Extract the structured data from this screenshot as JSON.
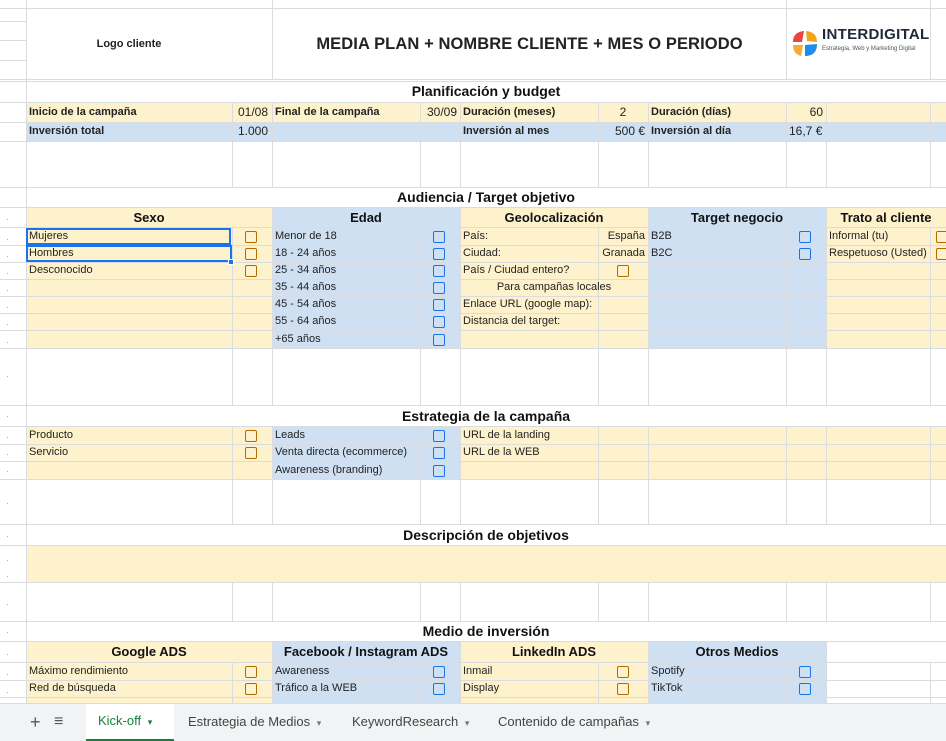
{
  "header": {
    "logo_placeholder": "Logo cliente",
    "title": "MEDIA PLAN + NOMBRE CLIENTE + MES O PERIODO",
    "brand_name": "INTERDIGITAL",
    "brand_tagline": "Estrategia, Web y Marketing Digital",
    "brand_colors": {
      "red": "#e8453c",
      "orange": "#f7a21b",
      "blue": "#1f8ee8"
    }
  },
  "planning": {
    "section_title": "Planificación y budget",
    "start_label": "Inicio de la campaña",
    "start_value": "01/08",
    "end_label": "Final de la campaña",
    "end_value": "30/09",
    "months_label": "Duración (meses)",
    "months_value": "2",
    "days_label": "Duración (días)",
    "days_value": "60",
    "total_label": "Inversión total",
    "total_value": "1.000",
    "monthly_label": "Inversión al mes",
    "monthly_value": "500 €",
    "daily_label": "Inversión al día",
    "daily_value": "16,7 €"
  },
  "audience": {
    "section_title": "Audiencia / Target objetivo",
    "sexo": {
      "header": "Sexo",
      "items": [
        "Mujeres",
        "Hombres",
        "Desconocido"
      ]
    },
    "edad": {
      "header": "Edad",
      "items": [
        "Menor de 18",
        "18 - 24 años",
        "25 - 34 años",
        "35 - 44 años",
        "45 - 54 años",
        "55 - 64 años",
        "+65 años"
      ]
    },
    "geo": {
      "header": "Geolocalización",
      "country_label": "País:",
      "country_value": "España",
      "city_label": "Ciudad:",
      "city_value": "Granada",
      "whole_label": "País / Ciudad entero?",
      "local_note": "Para campañas locales",
      "url_label": "Enlace URL (google map):",
      "distance_label": "Distancia del target:"
    },
    "target": {
      "header": "Target negocio",
      "items": [
        "B2B",
        "B2C"
      ]
    },
    "trato": {
      "header": "Trato al cliente",
      "items": [
        "Informal (tu)",
        "Respetuoso (Usted)"
      ]
    }
  },
  "strategy": {
    "section_title": "Estrategia de la campaña",
    "types": [
      "Producto",
      "Servicio"
    ],
    "goals": [
      "Leads",
      "Venta directa (ecommerce)",
      "Awareness (branding)"
    ],
    "landing_label": "URL de la landing",
    "web_label": "URL de la WEB"
  },
  "objectives": {
    "section_title": "Descripción de objetivos"
  },
  "investment": {
    "section_title": "Medio de inversión",
    "google": {
      "header": "Google ADS",
      "items": [
        "Máximo rendimiento",
        "Red de búsqueda"
      ]
    },
    "facebook": {
      "header": "Facebook / Instagram ADS",
      "items": [
        "Awareness",
        "Tráfico a la WEB"
      ]
    },
    "linkedin": {
      "header": "LinkedIn ADS",
      "items": [
        "Inmail",
        "Display"
      ]
    },
    "otros": {
      "header": "Otros Medios",
      "items": [
        "Spotify",
        "TikTok"
      ]
    }
  },
  "tabs": {
    "add": "+",
    "list": "≡",
    "items": [
      "Kick-off",
      "Estrategia de Medios",
      "KeywordResearch",
      "Contenido de campañas"
    ],
    "dropdown": "▾"
  }
}
